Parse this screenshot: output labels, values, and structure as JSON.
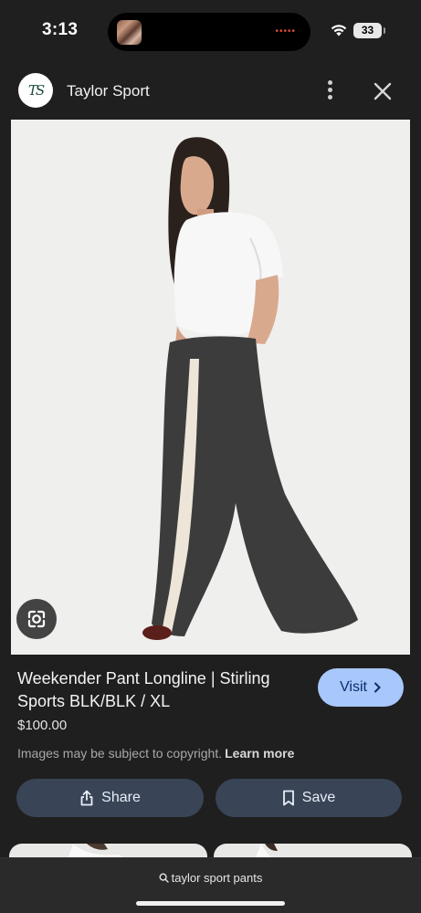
{
  "status_bar": {
    "time": "3:13",
    "battery": "33"
  },
  "header": {
    "source_logo_text": "TS",
    "source_name": "Taylor Sport"
  },
  "product": {
    "title": "Weekender Pant Longline | Stirling Sports BLK/BLK / XL",
    "price": "$100.00",
    "visit_label": "Visit",
    "copyright_text": "Images may be subject to copyright.",
    "learn_more_label": "Learn more"
  },
  "actions": {
    "share_label": "Share",
    "save_label": "Save"
  },
  "search": {
    "query": "taylor sport pants"
  },
  "colors": {
    "background": "#1f1f1f",
    "visit_button": "#a8c7fa",
    "action_button": "#394457"
  }
}
